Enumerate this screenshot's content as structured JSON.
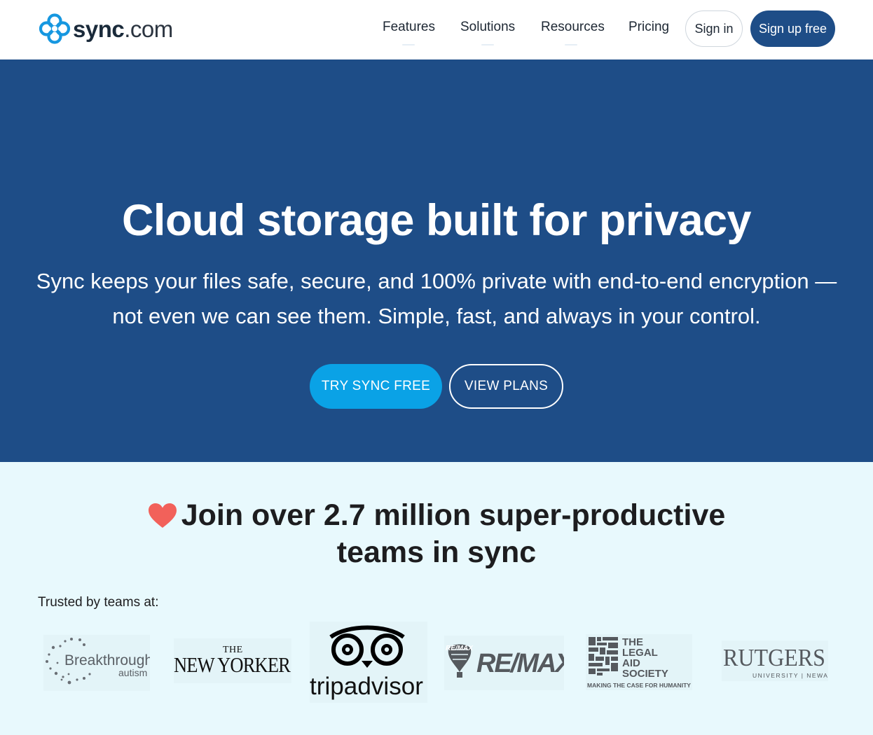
{
  "header": {
    "logo": {
      "word": "sync",
      "suffix": ".com"
    },
    "nav": [
      {
        "label": "Features"
      },
      {
        "label": "Solutions"
      },
      {
        "label": "Resources"
      },
      {
        "label": "Pricing"
      }
    ],
    "signin_label": "Sign in",
    "signup_label": "Sign up free"
  },
  "hero": {
    "title": "Cloud storage built for privacy",
    "subtitle_line1": "Sync keeps your files safe, secure, and 100% private with end-to-end encryption —",
    "subtitle_line2": "not even we can see them. Simple, fast, and always in your control.",
    "primary_cta": "TRY SYNC FREE",
    "secondary_cta": "VIEW PLANS"
  },
  "social_proof": {
    "heading_pre": "Join over ",
    "heading_number": "2.7 million",
    "heading_post_line1": " super-productive",
    "heading_line2": "teams in sync",
    "trusted_label": "Trusted by teams at:",
    "logos": [
      {
        "name": "Breakthrough",
        "sub": "autism"
      },
      {
        "top": "THE",
        "name": "NEW YORKER"
      },
      {
        "name": "tripadvisor"
      },
      {
        "name": "RE/MAX"
      },
      {
        "name": "THE LEGAL AID SOCIETY",
        "tagline": "MAKING THE CASE FOR HUMANITY"
      },
      {
        "name": "RUTGERS",
        "sub": "UNIVERSITY | NEWARK"
      }
    ]
  },
  "colors": {
    "brand_navy": "#1e4d87",
    "cta_blue": "#0aa2e6",
    "proof_bg": "#e8f9fd",
    "heart": "#f2615a"
  },
  "icons": [
    "sync-logo-icon",
    "heart-icon"
  ]
}
